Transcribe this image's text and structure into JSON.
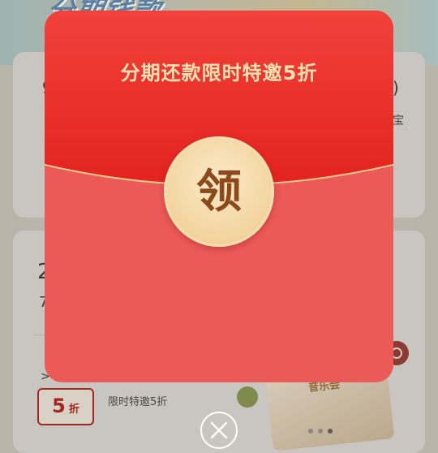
{
  "background": {
    "banner_title": "分期钱款",
    "edge_texts": {
      "bao": "宝",
      "big_digit": "2",
      "seven": "7",
      "gt": ">",
      "paren": ")",
      "nine": "9"
    },
    "discount_tag": {
      "number": "5",
      "unit": "折"
    },
    "promo_text": "限时特邀5折",
    "music_card_text": "音乐会",
    "carousel_active_index": 2
  },
  "modal": {
    "title": "分期还款限时特邀5折",
    "claim_label": "领"
  },
  "colors": {
    "envelope_body": "#ec5a58",
    "envelope_flap": "#e62a26",
    "title_gold": "#f8e2b3",
    "coin": "#f2d39c",
    "coin_text": "#8c4a1c"
  }
}
